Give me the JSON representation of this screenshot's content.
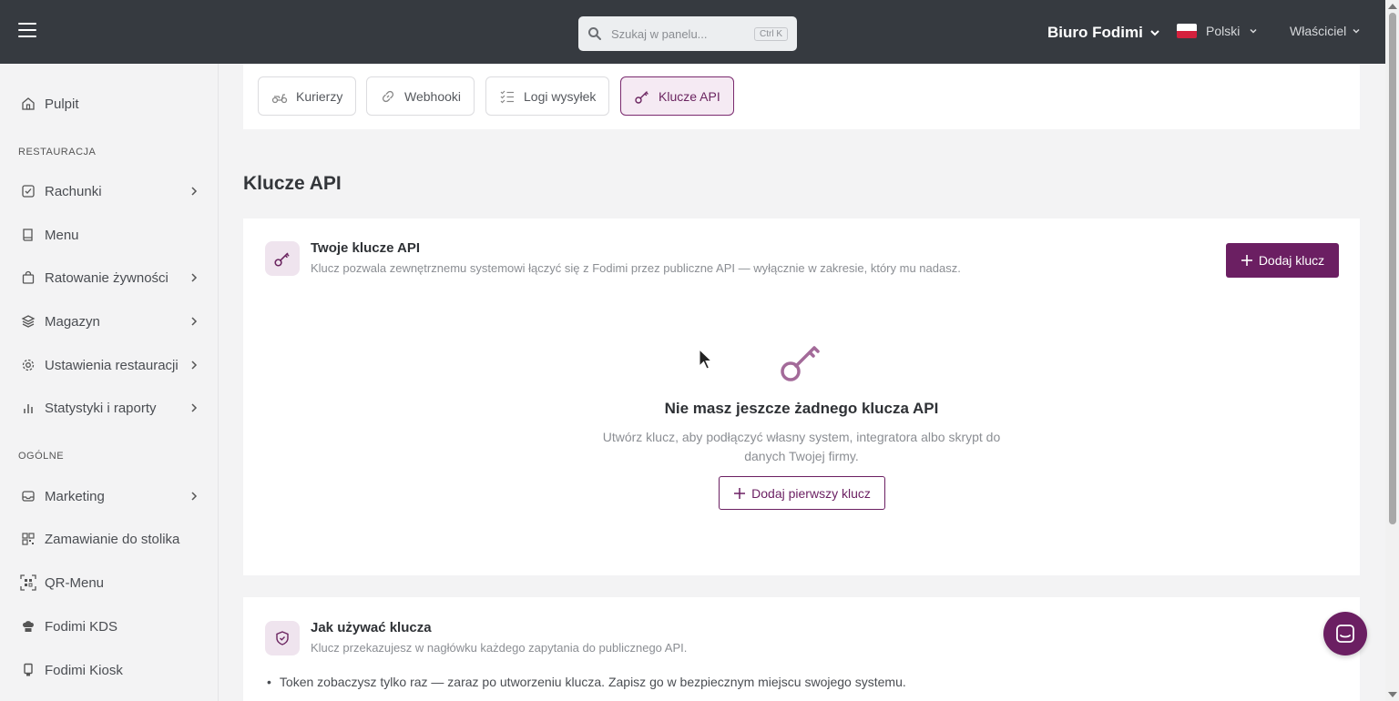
{
  "topbar": {
    "search_placeholder": "Szukaj w panelu...",
    "search_shortcut": "Ctrl K",
    "company": "Biuro Fodimi",
    "language": "Polski",
    "role": "Właściciel"
  },
  "sidebar": {
    "pulpit": "Pulpit",
    "section_restaurant": "RESTAURACJA",
    "items_restaurant": [
      "Rachunki",
      "Menu",
      "Ratowanie żywności",
      "Magazyn",
      "Ustawienia restauracji",
      "Statystyki i raporty"
    ],
    "section_general": "OGÓLNE",
    "items_general": [
      "Marketing",
      "Zamawianie do stolika",
      "QR-Menu",
      "Fodimi KDS",
      "Fodimi Kiosk"
    ]
  },
  "tabs": [
    "Kurierzy",
    "Webhooki",
    "Logi wysyłek",
    "Klucze API"
  ],
  "page_title": "Klucze API",
  "keys_card": {
    "title": "Twoje klucze API",
    "subtitle": "Klucz pozwala zewnętrznemu systemowi łączyć się z Fodimi przez publiczne API — wyłącznie w zakresie, który mu nadasz.",
    "add_button": "Dodaj klucz",
    "empty_title": "Nie masz jeszcze żadnego klucza API",
    "empty_text": "Utwórz klucz, aby podłączyć własny system, integratora albo skrypt do danych Twojej firmy.",
    "add_first_button": "Dodaj pierwszy klucz"
  },
  "usage_card": {
    "title": "Jak używać klucza",
    "subtitle": "Klucz przekazujesz w nagłówku każdego zapytania do publicznego API.",
    "bullet_1": "Token zobaczysz tylko raz — zaraz po utworzeniu klucza. Zapisz go w bezpiecznym miejscu swojego systemu."
  },
  "colors": {
    "topbar": "#363a40",
    "accent": "#6b1f62",
    "accent_light": "#efe4ee"
  }
}
